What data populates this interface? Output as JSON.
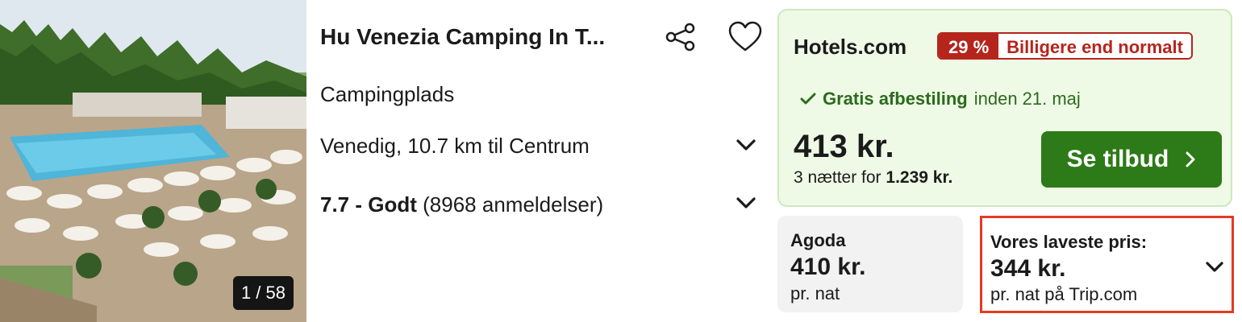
{
  "listing": {
    "title": "Hu Venezia Camping In T...",
    "photo_counter": "1 / 58",
    "type": "Campingplads",
    "location": "Venedig, 10.7 km til Centrum",
    "rating_score": "7.7 - Godt",
    "rating_reviews": "(8968 anmeldelser)"
  },
  "deal": {
    "provider": "Hotels.com",
    "discount_pct": "29 %",
    "discount_text": "Billigere end normalt",
    "cancel_bold": "Gratis afbestiling",
    "cancel_until": "inden 21. maj",
    "price": "413 kr.",
    "nights_prefix": "3 nætter for",
    "nights_total": "1.239 kr.",
    "cta_label": "Se tilbud"
  },
  "alt_offer": {
    "provider": "Agoda",
    "price": "410 kr.",
    "per": "pr. nat"
  },
  "lowest_offer": {
    "label": "Vores laveste pris:",
    "price": "344 kr.",
    "per": "pr. nat på Trip.com"
  },
  "icons": {
    "share": "share-icon",
    "favorite": "heart-icon",
    "check": "check-icon",
    "expand": "chevron-down-icon",
    "cta_arrow": "chevron-right-icon"
  },
  "colors": {
    "deal_bg": "#eefae6",
    "cta_green": "#2d7a18",
    "badge_red": "#b5251c",
    "highlight_border": "#e43a24"
  }
}
